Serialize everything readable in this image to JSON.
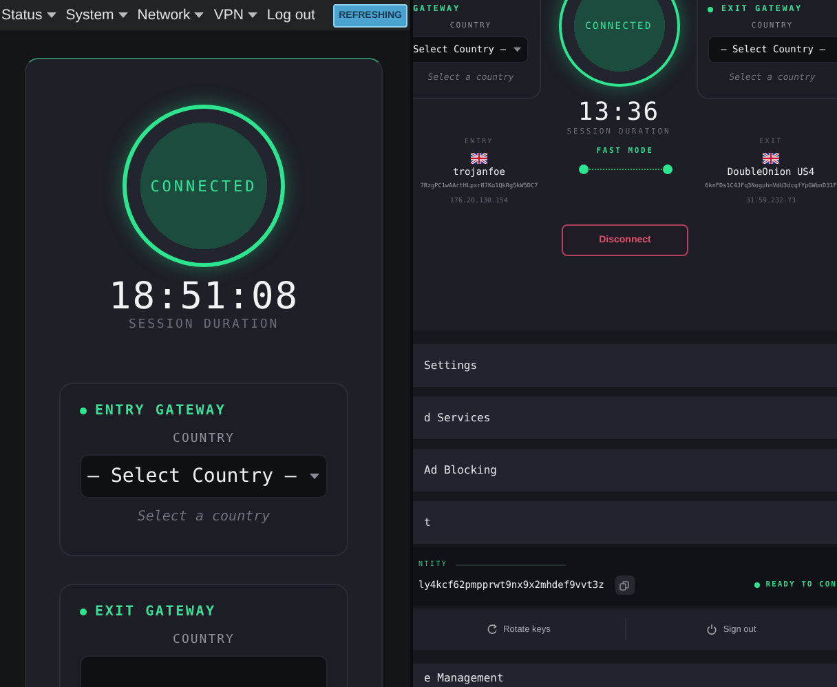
{
  "left_pane": {
    "nav": {
      "menus": [
        {
          "label": "Status",
          "kind": "dropdown"
        },
        {
          "label": "System",
          "kind": "dropdown"
        },
        {
          "label": "Network",
          "kind": "dropdown"
        },
        {
          "label": "VPN",
          "kind": "dropdown"
        },
        {
          "label": "Log out",
          "kind": "link"
        }
      ],
      "refresh_button": "REFRESHING"
    },
    "connection": {
      "status": "CONNECTED",
      "connected": true,
      "duration": "18:51:08",
      "duration_label": "SESSION DURATION"
    },
    "gateways": [
      {
        "title": "ENTRY GATEWAY",
        "field_label": "COUNTRY",
        "select_value": "– Select Country –",
        "caret": true,
        "hint": "Select a country"
      },
      {
        "title": "EXIT GATEWAY",
        "field_label": "COUNTRY",
        "caret": false
      }
    ]
  },
  "right_pane": {
    "gateways": [
      {
        "title": "GATEWAY",
        "field_label": "COUNTRY",
        "select_value": "Select Country –",
        "caret": true,
        "hint": "Select a country"
      },
      {
        "title": "EXIT GATEWAY",
        "field_label": "COUNTRY",
        "select_value": "– Select Country –",
        "caret": false,
        "hint": "Select a country"
      }
    ],
    "connection": {
      "status": "CONNECTED",
      "connected": true,
      "duration": "13:36",
      "duration_label": "SESSION DURATION"
    },
    "route": {
      "entry": {
        "label": "ENTRY",
        "name": "trojanfoe",
        "key": "7BzgPC1wAArtHLpxr87Ko1QkRg5kW5DC7",
        "ip": "176.20.130.154"
      },
      "mode": "FAST MODE",
      "exit": {
        "label": "EXIT",
        "name": "DoubleOnion US4",
        "key": "6knFDs1C4JFq3NoguhnVdU3dcqfYpGWbnD31F",
        "ip": "31.59.232.73"
      }
    },
    "disconnect_button": "Disconnect",
    "sections": [
      {
        "title": "Settings"
      },
      {
        "title": "d Services"
      },
      {
        "title": "Ad Blocking"
      },
      {
        "title": "t"
      }
    ],
    "identity": {
      "label": "NTITY",
      "address": "ly4kcf62pmpprwt9nx9x2mhdef9vvt3z",
      "status": "READY TO CON"
    },
    "actions": [
      {
        "label": "Rotate keys",
        "kind": "rotate"
      },
      {
        "label": "Sign out",
        "kind": "power"
      }
    ],
    "last_section": "e Management"
  }
}
